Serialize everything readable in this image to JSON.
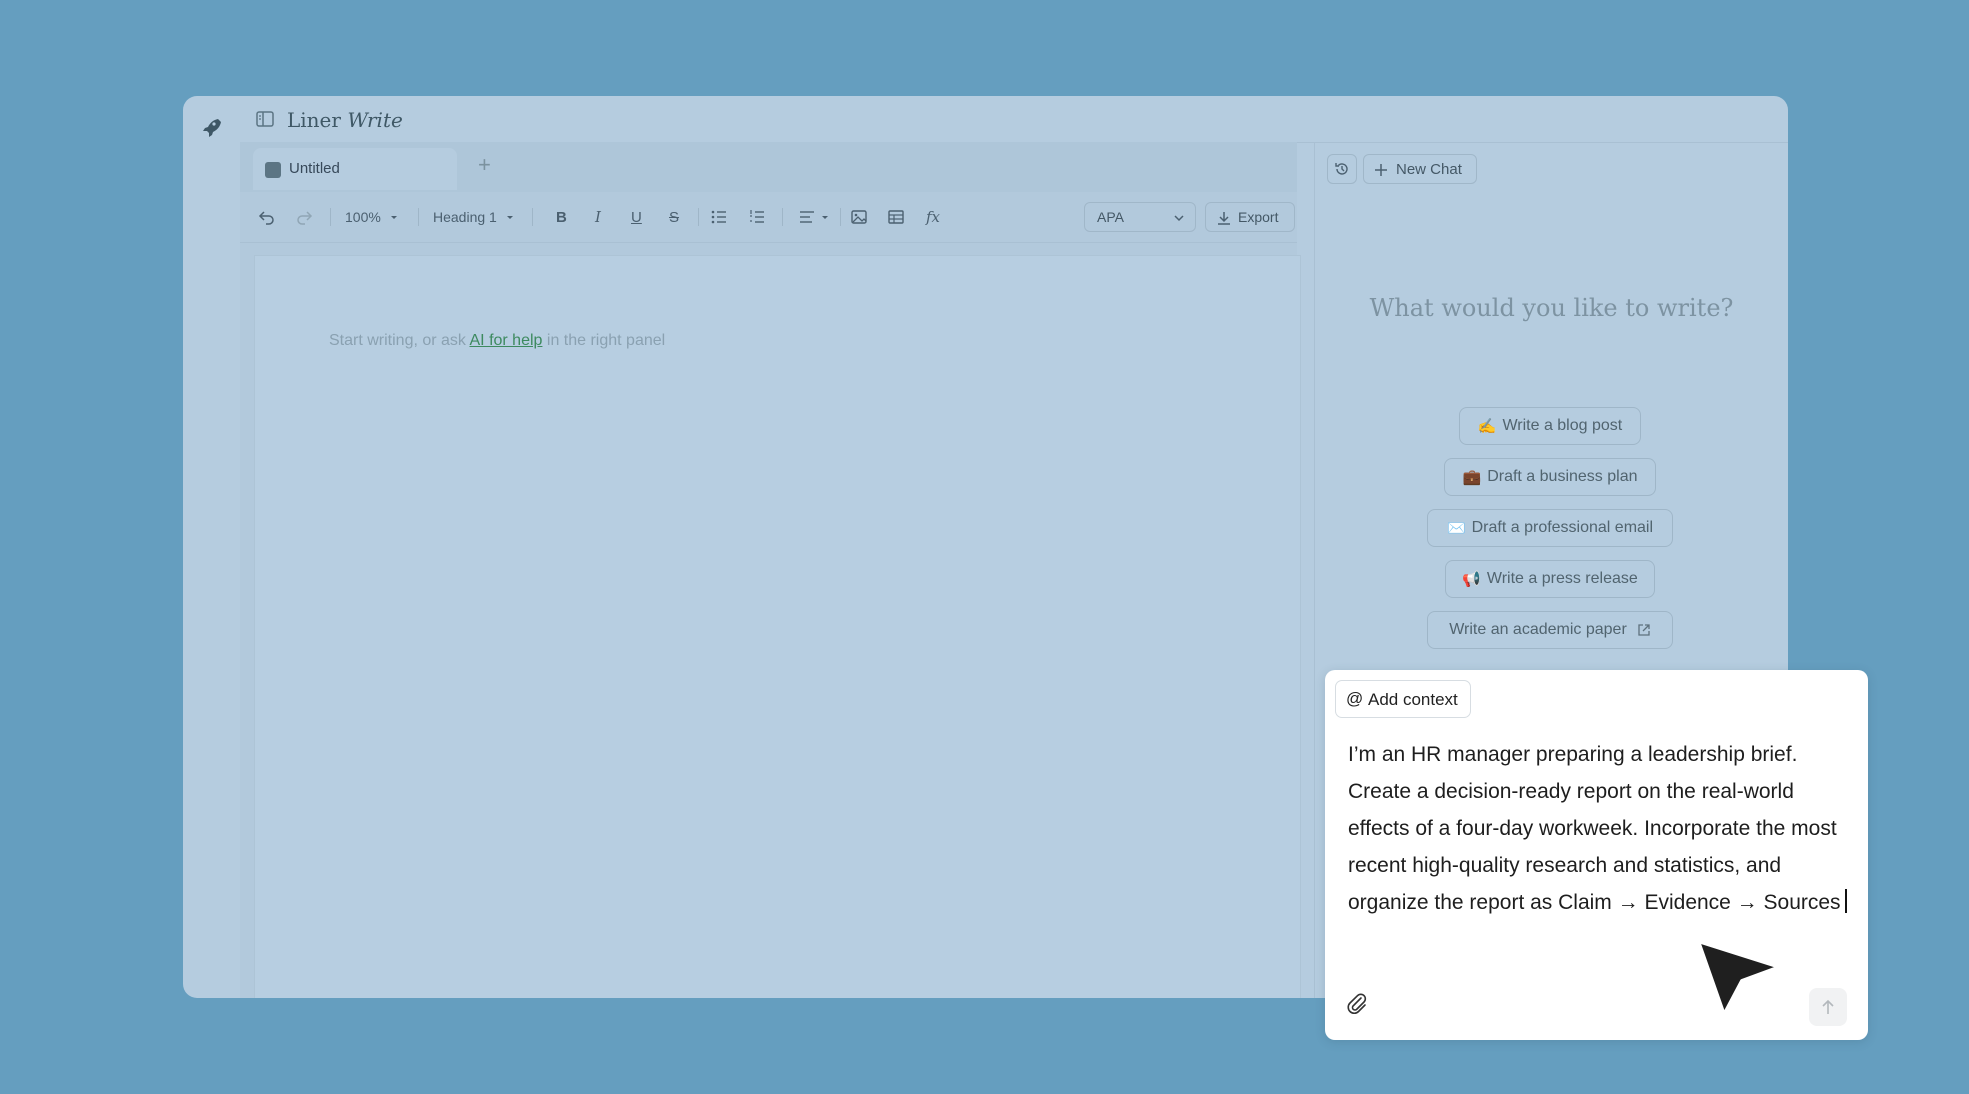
{
  "app": {
    "brand_prefix": "Liner",
    "brand_suffix": "Write"
  },
  "tabs": [
    {
      "label": "Untitled"
    }
  ],
  "tab_add_label": "+",
  "toolbar": {
    "zoom": "100%",
    "style": "Heading 1",
    "citation_style": "APA",
    "export_label": "Export",
    "bold_label": "B",
    "italic_label": "I",
    "underline_label": "U",
    "strike_label": "S",
    "formula_label": "fx"
  },
  "editor": {
    "placeholder_before": "Start writing, or ask ",
    "placeholder_link": "AI for help",
    "placeholder_after": " in the right panel"
  },
  "chat_panel": {
    "new_chat_label": "New Chat",
    "prompt_title": "What would you like to write?",
    "suggestions": [
      {
        "icon": "✍️",
        "label": "Write a blog post"
      },
      {
        "icon": "💼",
        "label": "Draft a business plan"
      },
      {
        "icon": "✉️",
        "label": "Draft a professional email"
      },
      {
        "icon": "📢",
        "label": "Write a press release"
      },
      {
        "icon": "",
        "label": "Write an academic paper"
      }
    ]
  },
  "chat_input": {
    "add_context_label": "Add context",
    "at_symbol": "@",
    "message": "I’m an HR manager preparing a leadership brief. Create a decision-ready report on the real-world effects of a four-day workweek. Incorporate the most recent high-quality research and statistics, and organize the report as Claim → Evidence → Sources"
  },
  "colors": {
    "background": "#659ebf",
    "app_surface": "#b5ccdf",
    "link_green": "#3d8a5f",
    "chat_surface": "#ffffff"
  }
}
